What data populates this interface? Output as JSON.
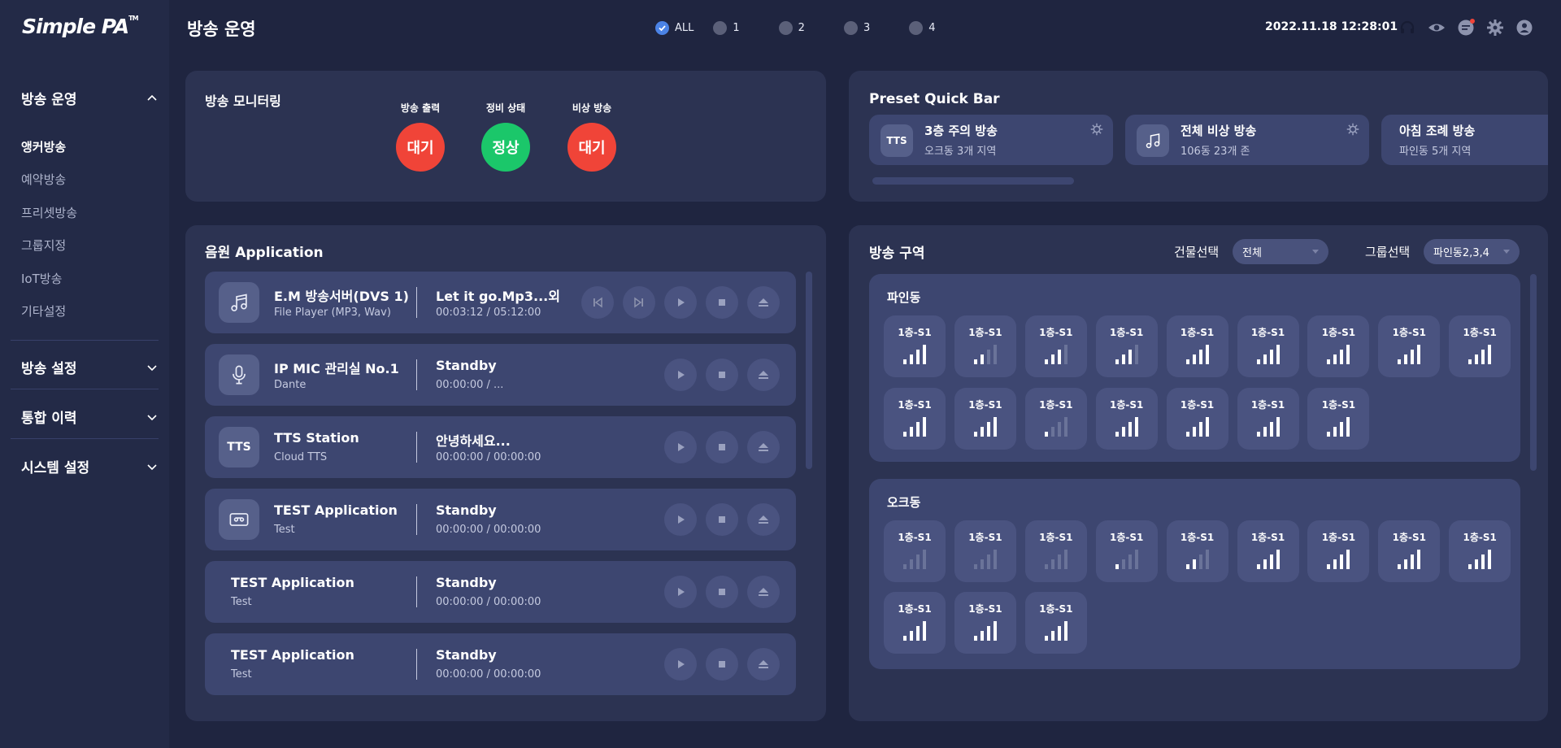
{
  "sidebar": {
    "logo": "Simple PA",
    "logo_tm": "TM",
    "sections": [
      {
        "label": "방송 운영",
        "expanded": true,
        "items": [
          {
            "label": "앵커방송",
            "active": true
          },
          {
            "label": "예약방송",
            "active": false
          },
          {
            "label": "프리셋방송",
            "active": false
          },
          {
            "label": "그룹지정",
            "active": false
          },
          {
            "label": "IoT방송",
            "active": false
          },
          {
            "label": "기타설정",
            "active": false
          }
        ]
      },
      {
        "label": "방송 설정",
        "expanded": false
      },
      {
        "label": "통합 이력",
        "expanded": false
      },
      {
        "label": "시스템 설정",
        "expanded": false
      }
    ]
  },
  "header": {
    "title": "방송 운영",
    "filters": [
      {
        "label": "ALL",
        "checked": true
      },
      {
        "label": "1",
        "checked": false
      },
      {
        "label": "2",
        "checked": false
      },
      {
        "label": "3",
        "checked": false
      },
      {
        "label": "4",
        "checked": false
      }
    ],
    "datetime": "2022.11.18  12:28:01",
    "icons": [
      "headset-icon",
      "eye-icon",
      "chat-icon",
      "gear-icon",
      "user-icon"
    ]
  },
  "monitoring": {
    "title": "방송 모니터링",
    "statuses": [
      {
        "label": "방송 출력",
        "value": "대기",
        "color": "#f04438"
      },
      {
        "label": "정비 상태",
        "value": "정상",
        "color": "#1bc76a"
      },
      {
        "label": "비상 방송",
        "value": "대기",
        "color": "#f04438"
      }
    ]
  },
  "preset": {
    "title": "Preset Quick Bar",
    "items": [
      {
        "icon_text": "TTS",
        "icon": "tts-icon",
        "title": "3층 주의 방송",
        "sub": "오크동 3개 지역"
      },
      {
        "icon_text": "",
        "icon": "music-note-icon",
        "title": "전체 비상 방송",
        "sub": "106동 23개 존"
      },
      {
        "icon_text": "",
        "icon": "",
        "title": "아침 조례 방송",
        "sub": "파인동 5개 지역"
      }
    ]
  },
  "sources": {
    "title": "음원 Application",
    "rows": [
      {
        "icon": "music-note-icon",
        "icon_text": "",
        "name": "E.M 방송서버(DVS 1)",
        "type": "File Player (MP3, Wav)",
        "track": "Let it go.Mp3...외",
        "time": "00:03:12 / 05:12:00",
        "controls": [
          "prev",
          "next",
          "play",
          "stop",
          "eject"
        ]
      },
      {
        "icon": "microphone-icon",
        "icon_text": "",
        "name": "IP MIC 관리실 No.1",
        "type": "Dante",
        "track": "Standby",
        "time": "00:00:00 / ...",
        "controls": [
          "play",
          "stop",
          "eject"
        ]
      },
      {
        "icon": "tts-icon",
        "icon_text": "TTS",
        "name": "TTS Station",
        "type": "Cloud TTS",
        "track": "안녕하세요...",
        "time": "00:00:00 / 00:00:00",
        "controls": [
          "play",
          "stop",
          "eject"
        ]
      },
      {
        "icon": "cassette-icon",
        "icon_text": "",
        "name": "TEST Application",
        "type": "Test",
        "track": "Standby",
        "time": "00:00:00 / 00:00:00",
        "controls": [
          "play",
          "stop",
          "eject"
        ]
      },
      {
        "icon": "",
        "icon_text": "",
        "name": "TEST Application",
        "type": "Test",
        "track": "Standby",
        "time": "00:00:00 / 00:00:00",
        "controls": [
          "play",
          "stop",
          "eject"
        ]
      },
      {
        "icon": "",
        "icon_text": "",
        "name": "TEST Application",
        "type": "Test",
        "track": "Standby",
        "time": "00:00:00 / 00:00:00",
        "controls": [
          "play",
          "stop",
          "eject"
        ]
      }
    ]
  },
  "zones": {
    "title": "방송 구역",
    "building_label": "건물선택",
    "building_value": "전체",
    "group_label": "그룹선택",
    "group_value": "파인동2,3,4",
    "buildings": [
      {
        "name": "파인동",
        "speakers": [
          {
            "label": "1층-S1",
            "level": 4
          },
          {
            "label": "1층-S1",
            "level": 2
          },
          {
            "label": "1층-S1",
            "level": 3
          },
          {
            "label": "1층-S1",
            "level": 3
          },
          {
            "label": "1층-S1",
            "level": 4
          },
          {
            "label": "1층-S1",
            "level": 4
          },
          {
            "label": "1층-S1",
            "level": 4
          },
          {
            "label": "1층-S1",
            "level": 4
          },
          {
            "label": "1층-S1",
            "level": 4
          },
          {
            "label": "1층-S1",
            "level": 4
          },
          {
            "label": "1층-S1",
            "level": 4
          },
          {
            "label": "1층-S1",
            "level": 1
          },
          {
            "label": "1층-S1",
            "level": 4
          },
          {
            "label": "1층-S1",
            "level": 4
          },
          {
            "label": "1층-S1",
            "level": 4
          },
          {
            "label": "1층-S1",
            "level": 4
          }
        ]
      },
      {
        "name": "오크동",
        "speakers": [
          {
            "label": "1층-S1",
            "level": 0
          },
          {
            "label": "1층-S1",
            "level": 0
          },
          {
            "label": "1층-S1",
            "level": 0
          },
          {
            "label": "1층-S1",
            "level": 1
          },
          {
            "label": "1층-S1",
            "level": 2
          },
          {
            "label": "1층-S1",
            "level": 4
          },
          {
            "label": "1층-S1",
            "level": 4
          },
          {
            "label": "1층-S1",
            "level": 4
          },
          {
            "label": "1층-S1",
            "level": 4
          },
          {
            "label": "1층-S1",
            "level": 4
          },
          {
            "label": "1층-S1",
            "level": 4
          },
          {
            "label": "1층-S1",
            "level": 4
          }
        ]
      }
    ]
  },
  "colors": {
    "accent": "#4b83e6",
    "alert": "#f04438",
    "ok": "#1bc76a"
  }
}
